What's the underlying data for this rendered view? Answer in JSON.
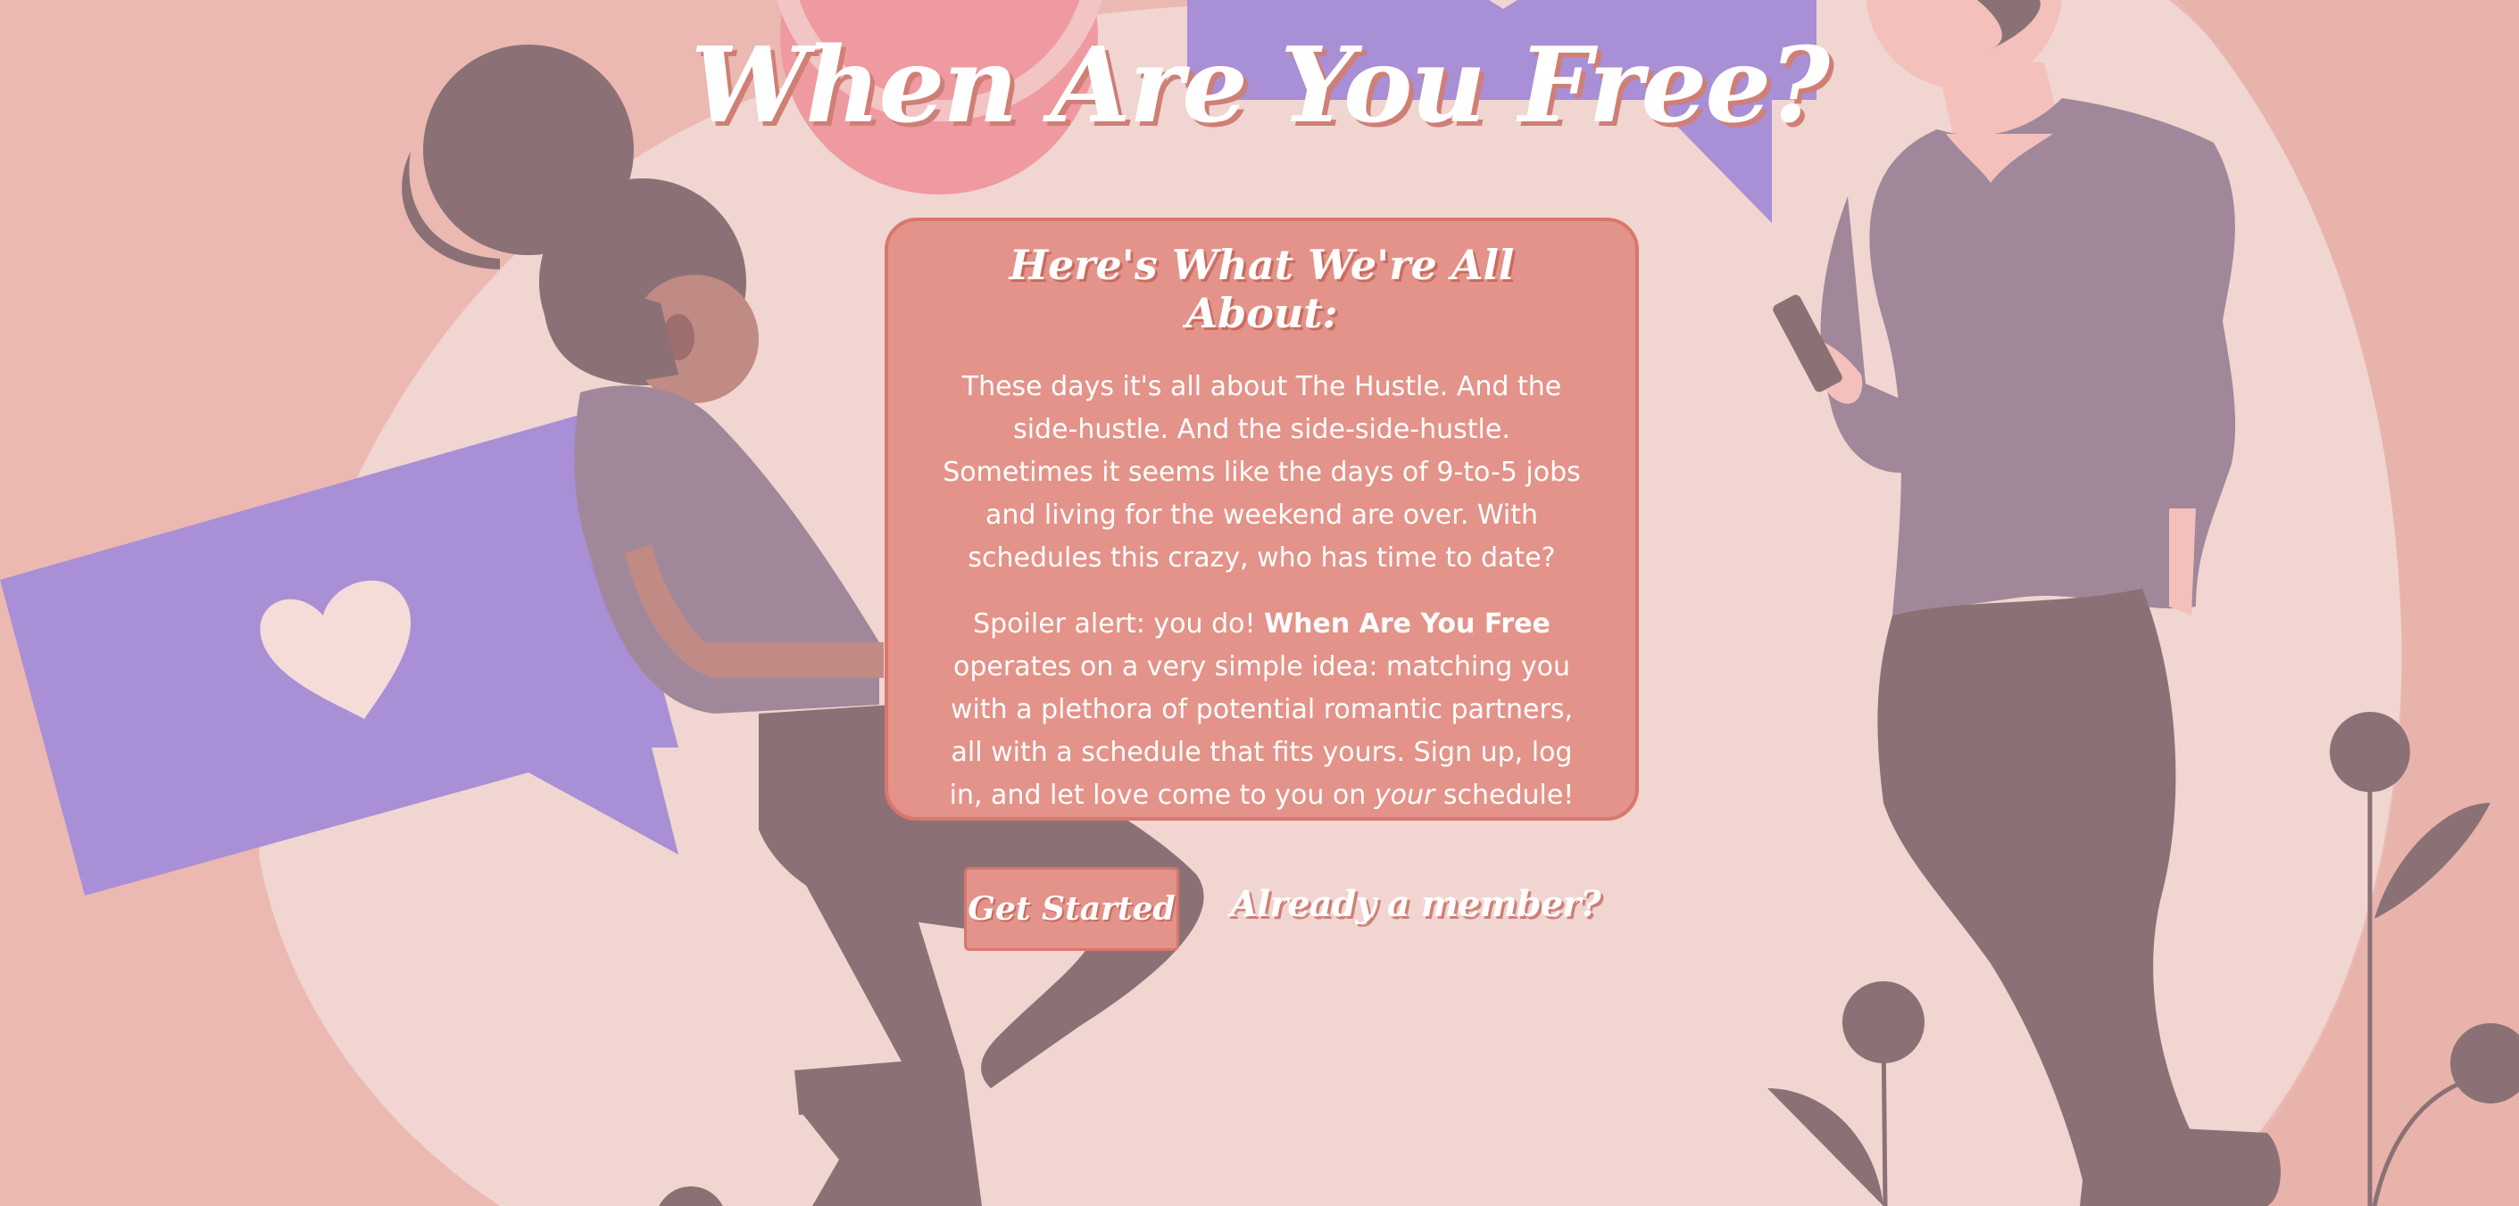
{
  "site": {
    "title": "When Are You Free?"
  },
  "about": {
    "heading": "Here's What We're All About:",
    "paragraph1": "These days it's all about The Hustle. And the side-hustle. And the side-side-hustle. Sometimes it seems like the days of 9-to-5 jobs and living for the weekend are over. With schedules this crazy, who has time to date?",
    "paragraph2_before": "Spoiler alert: you do! ",
    "paragraph2_brand": "When Are You Free",
    "paragraph2_middle": " operates on a very simple idea: matching you with a plethora of potential romantic partners, all with a schedule that fits yours. Sign up, log in, and let love come to you on ",
    "paragraph2_emphasis": "your",
    "paragraph2_after": " schedule!"
  },
  "actions": {
    "get_started_label": "Get Started",
    "member_link_label": "Already a member?"
  },
  "colors": {
    "background": "#ebb9b1",
    "center_blob": "#f0d5d1",
    "card": "#e39389",
    "card_border": "#d9776c",
    "bubble_purple": "#a98fd6",
    "figure_dark": "#8b7175",
    "shirt_purple": "#a0889a",
    "skin": "#c08a85",
    "heart": "#f5dcd8"
  },
  "icons": {
    "left_bubble": "heart-icon"
  }
}
